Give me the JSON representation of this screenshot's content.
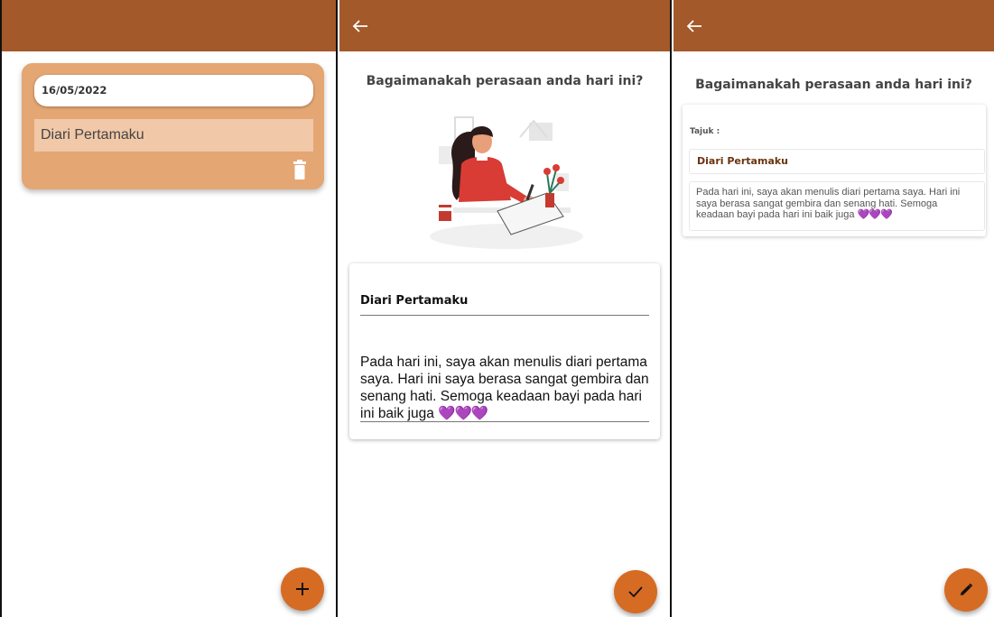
{
  "screen_list": {
    "entry": {
      "date": "16/05/2022",
      "title": "Diari Pertamaku"
    },
    "icons": {
      "delete": "trash-icon",
      "add": "plus-icon"
    }
  },
  "screen_edit": {
    "question": "Bagaimanakah perasaan anda hari ini?",
    "title_value": "Diari Pertamaku",
    "body_value": "Pada hari ini, saya akan menulis diari pertama saya. Hari ini saya berasa sangat gembira dan senang hati. Semoga keadaan bayi pada hari ini baik juga",
    "hearts": "💜💜💜",
    "icons": {
      "back": "arrow-left-icon",
      "save": "check-icon"
    }
  },
  "screen_view": {
    "question": "Bagaimanakah perasaan anda hari ini?",
    "tajuk_label": "Tajuk :",
    "title": "Diari Pertamaku",
    "body": "Pada hari ini, saya akan menulis diari pertama saya. Hari ini saya berasa sangat gembira dan senang hati. Semoga keadaan bayi pada hari ini baik juga",
    "hearts": "💜💜💜",
    "icons": {
      "back": "arrow-left-icon",
      "edit": "pencil-icon"
    }
  },
  "colors": {
    "appbar": "#a3592a",
    "card": "#e4a673",
    "fab": "#d66b24"
  }
}
